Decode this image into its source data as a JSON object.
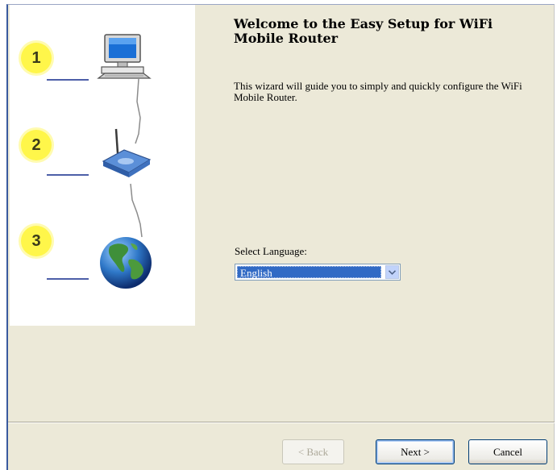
{
  "wizard": {
    "title": "Welcome to the Easy Setup for WiFi Mobile Router",
    "description": "This wizard will guide you to simply and quickly configure the WiFi Mobile Router."
  },
  "steps": [
    {
      "number": "1",
      "icon": "computer-icon"
    },
    {
      "number": "2",
      "icon": "router-icon"
    },
    {
      "number": "3",
      "icon": "globe-icon"
    }
  ],
  "language": {
    "label": "Select Language:",
    "selected": "English"
  },
  "buttons": {
    "back": "< Back",
    "next": "Next >",
    "cancel": "Cancel"
  },
  "colors": {
    "badge": "#fff64a",
    "selection": "#316ac5",
    "window_bg": "#ece9d8"
  }
}
